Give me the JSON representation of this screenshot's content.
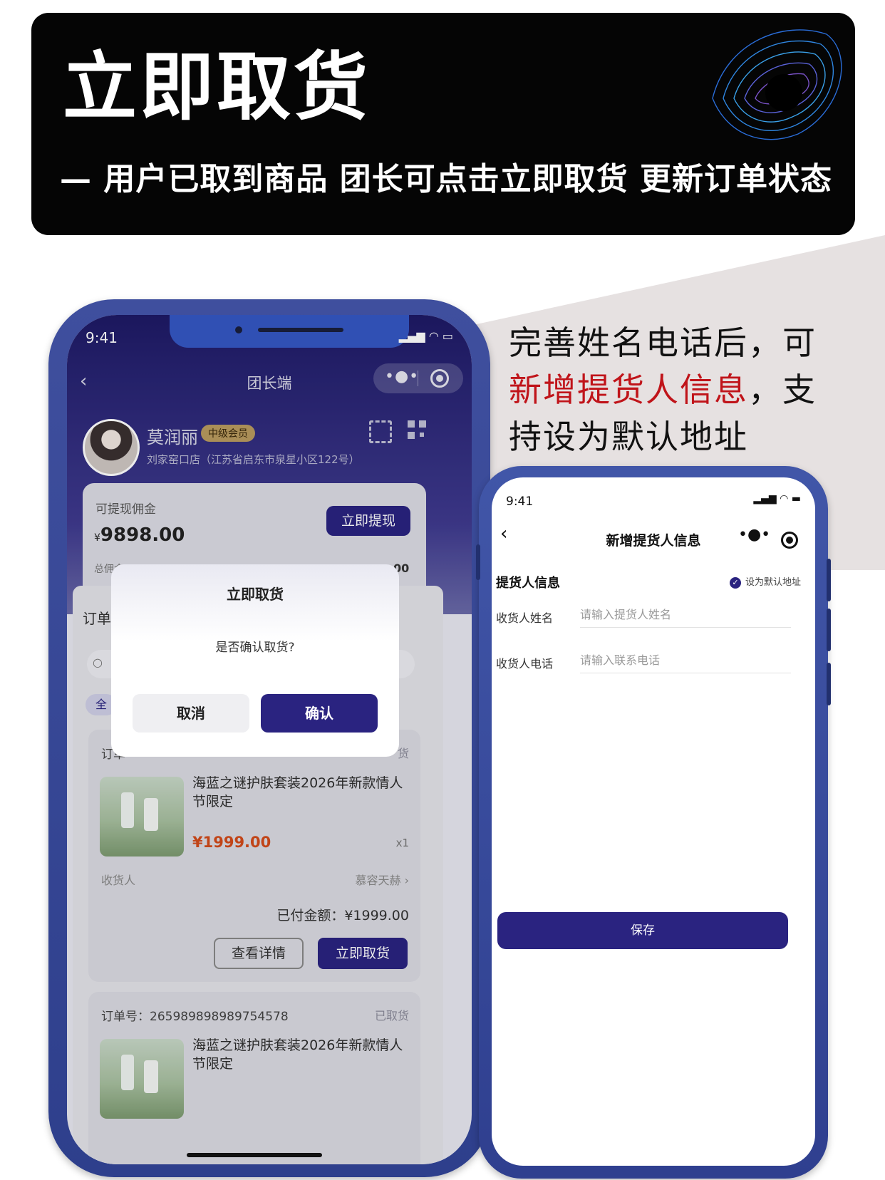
{
  "banner": {
    "title": "立即取货",
    "subtitle": "— 用户已取到商品 团长可点击立即取货 更新订单状态"
  },
  "caption": {
    "line1": "完善姓名电话后，可",
    "line2_red": "新增提货人信息",
    "line2_rest": "，支",
    "line3": "持设为默认地址"
  },
  "phone1": {
    "status_time": "9:41",
    "nav_title": "团长端",
    "user": {
      "name": "莫润丽",
      "badge": "中级会员",
      "address": "刘家窑口店（江苏省启东市泉星小区122号）"
    },
    "commission": {
      "label": "可提现佣金",
      "currency": "¥",
      "value": "9898.00",
      "withdraw_button": "立即提现",
      "footer_text": "总佣金",
      "footer_value": "00"
    },
    "tab_label": "订单",
    "filter_chip": "全",
    "modal": {
      "title": "立即取货",
      "message": "是否确认取货?",
      "cancel": "取消",
      "confirm": "确认"
    },
    "orders": [
      {
        "order_no": "订单",
        "status": "货",
        "product_name": "海蓝之谜护肤套装2026年新款情人节限定",
        "price": "¥1999.00",
        "qty": "x1",
        "receiver_label": "收货人",
        "receiver_name": "慕容天赫  ›",
        "paid": "已付金额：¥1999.00",
        "detail_button": "查看详情",
        "pickup_button": "立即取货"
      },
      {
        "order_no": "订单号：265989898989754578",
        "status": "已取货",
        "product_name": "海蓝之谜护肤套装2026年新款情人节限定"
      }
    ]
  },
  "phone2": {
    "status_time": "9:41",
    "nav_title": "新增提货人信息",
    "section_title": "提货人信息",
    "default_label": "设为默认地址",
    "fields": [
      {
        "label": "收货人姓名",
        "placeholder": "请输入提货人姓名"
      },
      {
        "label": "收货人电话",
        "placeholder": "请输入联系电话"
      }
    ],
    "save_button": "保存"
  },
  "colors": {
    "accent": "#2a2380",
    "highlight_red": "#c0141a",
    "price_orange": "#d24a1a",
    "banner_bg": "#050505",
    "phone_frame": "#3f4f9e"
  },
  "icons": [
    "back-icon",
    "more-icon",
    "target-icon",
    "scan-icon",
    "qr-code-icon",
    "search-icon",
    "check-icon",
    "signal-icon",
    "wifi-icon",
    "battery-icon"
  ]
}
